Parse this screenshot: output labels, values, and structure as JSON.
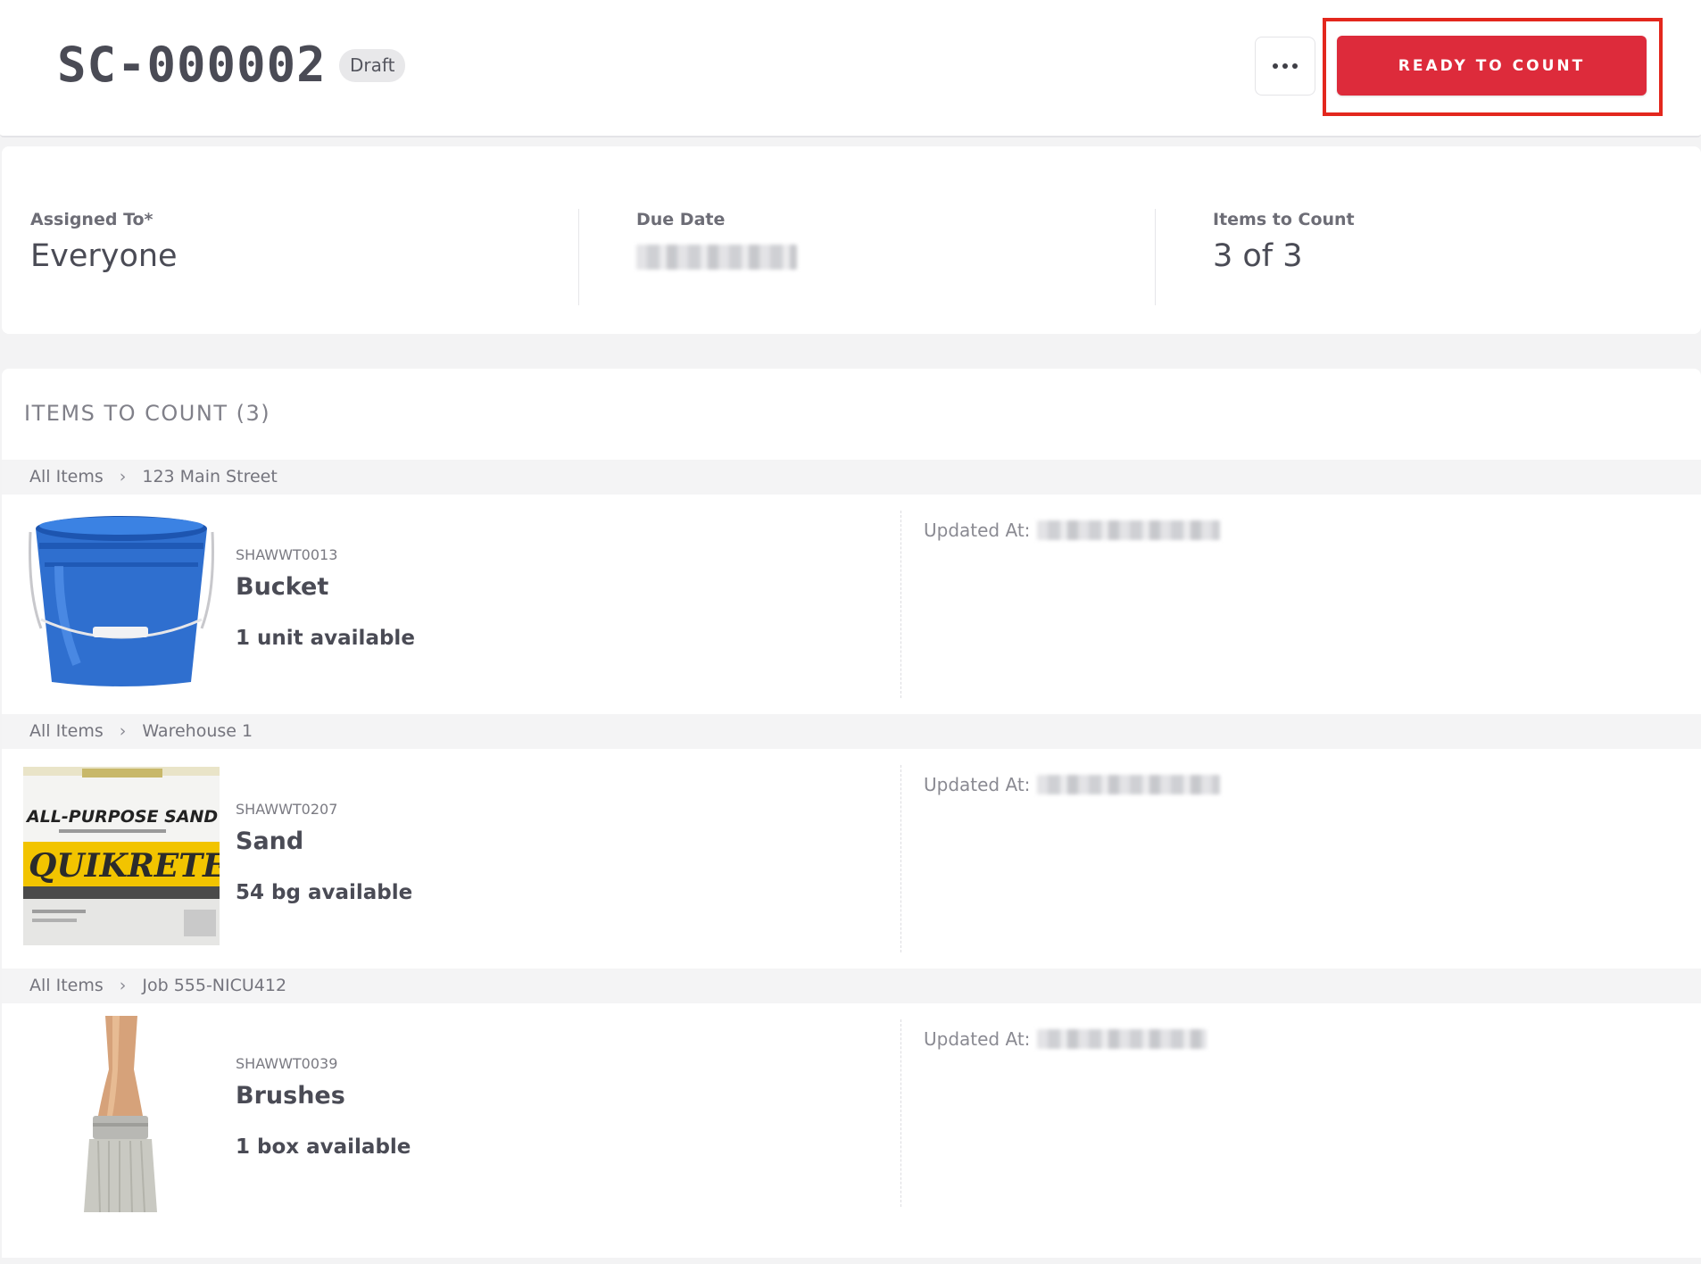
{
  "header": {
    "title": "SC-000002",
    "status": "Draft",
    "primary_action": "READY TO COUNT"
  },
  "summary": {
    "assigned_label": "Assigned To*",
    "assigned_value": "Everyone",
    "due_label": "Due Date",
    "items_label": "Items to Count",
    "items_value": "3 of 3"
  },
  "items_section": {
    "heading": "ITEMS TO COUNT (3)",
    "updated_label": "Updated At:",
    "groups": [
      {
        "crumb_root": "All Items",
        "crumb_location": "123 Main Street",
        "sku": "SHAWWT0013",
        "name": "Bucket",
        "quantity": "1 unit available",
        "image": "blue-bucket"
      },
      {
        "crumb_root": "All Items",
        "crumb_location": "Warehouse 1",
        "sku": "SHAWWT0207",
        "name": "Sand",
        "quantity": "54 bg available",
        "image": "sand-bag",
        "image_text_1": "ALL-PURPOSE SAND",
        "image_text_2": "QUIKRETE"
      },
      {
        "crumb_root": "All Items",
        "crumb_location": "Job 555-NICU412",
        "sku": "SHAWWT0039",
        "name": "Brushes",
        "quantity": "1 box available",
        "image": "paint-brush"
      }
    ]
  },
  "colors": {
    "accent": "#dd2b3b",
    "highlight": "#e3271d"
  }
}
